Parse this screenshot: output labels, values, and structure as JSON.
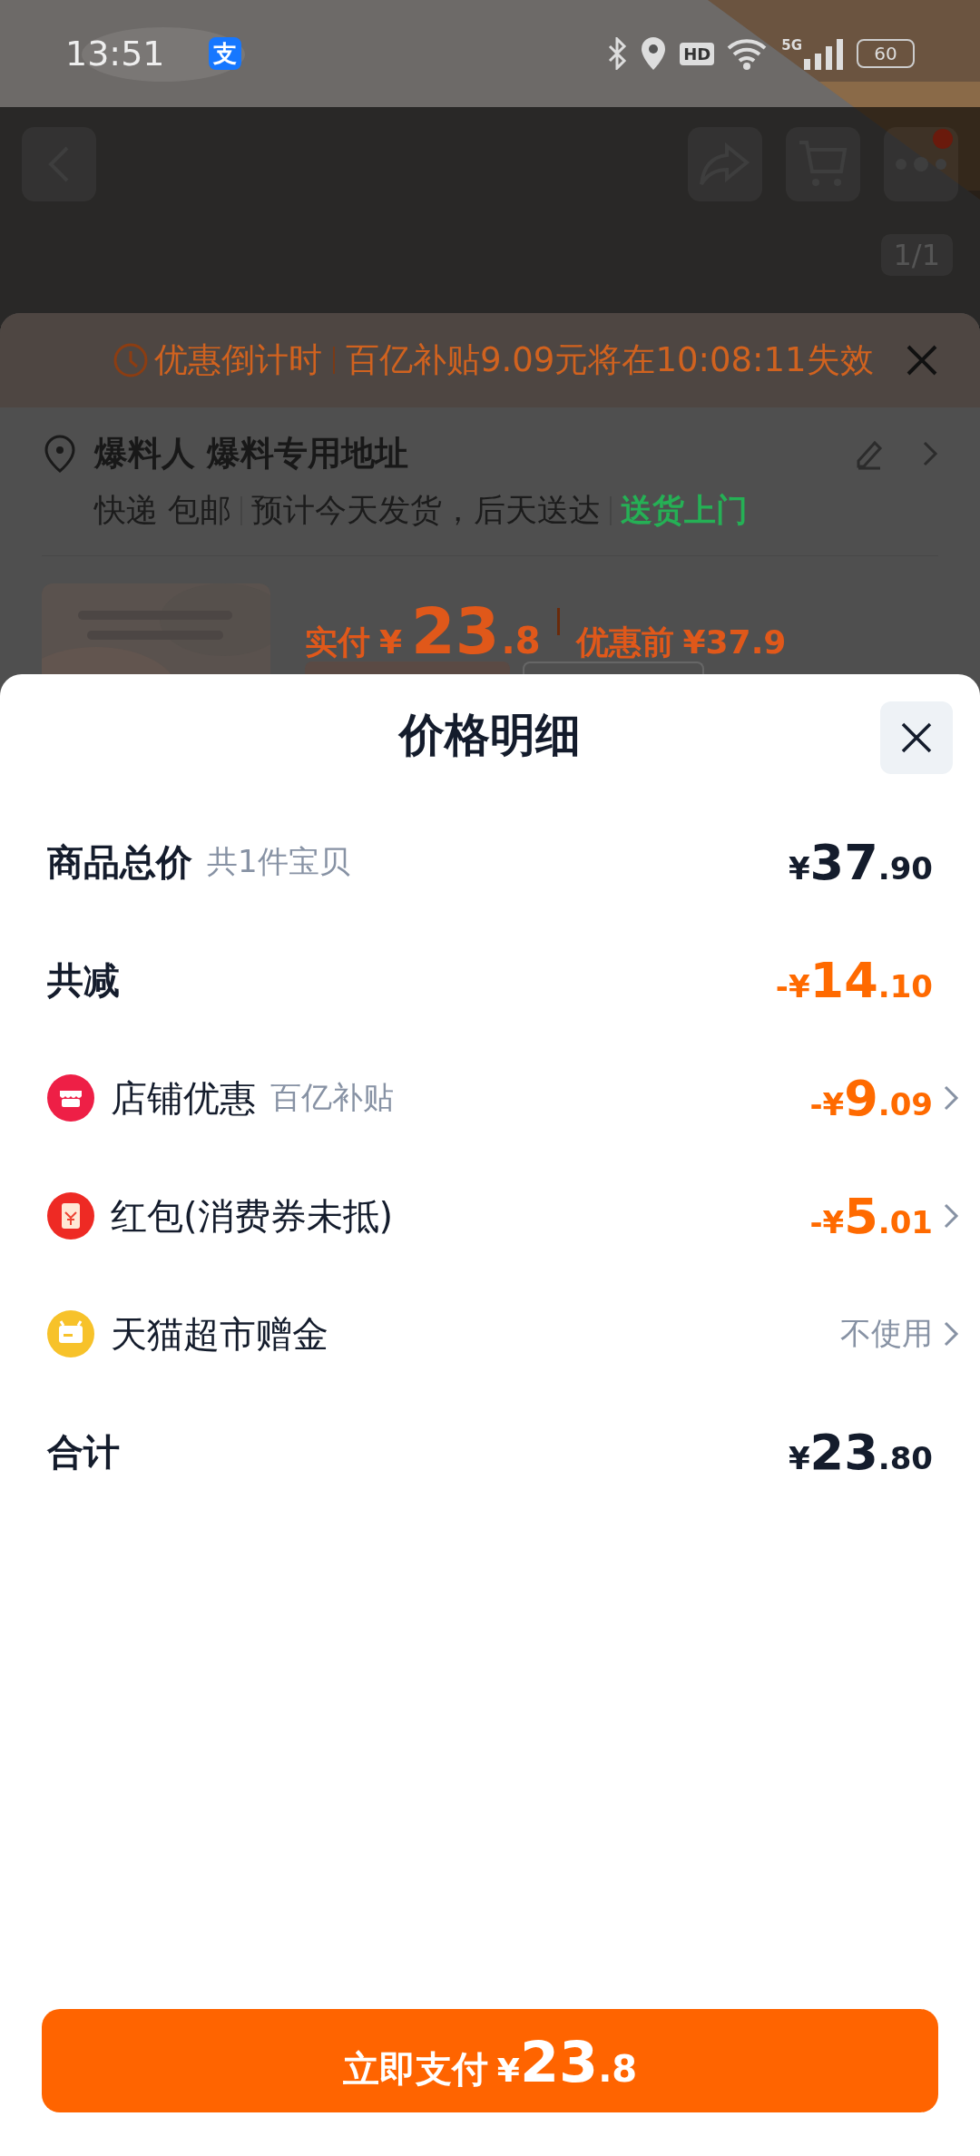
{
  "status_bar": {
    "time": "13:51",
    "app_glyph": "支",
    "hd": "HD",
    "network": "5G",
    "battery": "60"
  },
  "page_header": {
    "page_counter": "1/1",
    "more_badge": true
  },
  "order_card": {
    "countdown": {
      "label": "优惠倒计时",
      "message": "百亿补贴9.09元将在10:08:11失效"
    },
    "address": {
      "title": "爆料人 爆料专用地址",
      "shipping": "快递 包邮",
      "estimate": "预计今天发货，后天送达",
      "delivery": "送货上门"
    },
    "price": {
      "paid_label": "实付",
      "currency": "¥",
      "paid_integer": "23",
      "paid_decimal": ".8",
      "original_label": "优惠前",
      "original": "¥37.9"
    }
  },
  "sheet": {
    "title": "价格明细",
    "rows": [
      {
        "kind": "summary",
        "label": "商品总价",
        "note": "共1件宝贝",
        "amount": {
          "currency": "¥",
          "integer": "37",
          "decimal": ".90"
        },
        "discount": false,
        "chevron": false
      },
      {
        "kind": "summary",
        "label": "共减",
        "amount": {
          "sign": "-",
          "currency": "¥",
          "integer": "14",
          "decimal": ".10"
        },
        "discount": true,
        "chevron": false
      },
      {
        "kind": "item",
        "label": "店铺优惠",
        "note": "百亿补贴",
        "amount": {
          "sign": "-",
          "currency": "¥",
          "integer": "9",
          "decimal": ".09"
        },
        "discount": true,
        "chevron": true
      },
      {
        "kind": "item",
        "label": "红包(消费券未抵)",
        "amount": {
          "sign": "-",
          "currency": "¥",
          "integer": "5",
          "decimal": ".01"
        },
        "discount": true,
        "chevron": true
      },
      {
        "kind": "item",
        "label": "天猫超市赠金",
        "value": "不使用",
        "discount": false,
        "chevron": true
      },
      {
        "kind": "summary",
        "label": "合计",
        "amount": {
          "currency": "¥",
          "integer": "23",
          "decimal": ".80"
        },
        "discount": false,
        "chevron": false
      }
    ]
  },
  "pay_button": {
    "label": "立即支付",
    "currency": "¥",
    "integer": "23",
    "decimal": ".8"
  }
}
